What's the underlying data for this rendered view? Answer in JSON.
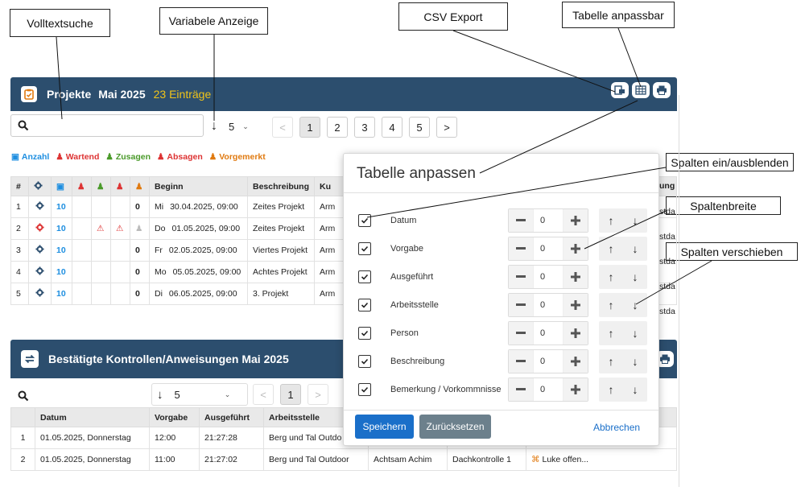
{
  "callouts": {
    "fulltext": "Volltextsuche",
    "variable": "Variabele Anzeige",
    "csv": "CSV Export",
    "table_adjustable": "Tabelle anpassbar",
    "toggle_cols": "Spalten ein/ausblenden",
    "col_width": "Spaltenbreite",
    "move_cols": "Spalten verschieben"
  },
  "projects": {
    "title": "Projekte",
    "period": "Mai 2025",
    "count": "23 Einträge",
    "page_size": "5",
    "pages": [
      "<",
      "1",
      "2",
      "3",
      "4",
      "5",
      ">"
    ],
    "legend": [
      {
        "label": "Anzahl",
        "color": "#1d8ee0"
      },
      {
        "label": "Wartend",
        "color": "#d33"
      },
      {
        "label": "Zusagen",
        "color": "#4a9a2a"
      },
      {
        "label": "Absagen",
        "color": "#d33"
      },
      {
        "label": "Vorgemerkt",
        "color": "#e07a10"
      }
    ],
    "columns": [
      "#",
      "",
      "",
      "",
      "",
      "",
      "",
      "Beginn",
      "Beschreibung",
      "Ku"
    ],
    "rows": [
      {
        "no": "1",
        "n": "10",
        "c5": "0",
        "day": "Mi",
        "date": "30.04.2025, 09:00",
        "desc": "Zeites Projekt",
        "cust": "Arm",
        "tail": "stda",
        "gear": "#2c4e6e",
        "warn": false
      },
      {
        "no": "2",
        "n": "10",
        "c5": "",
        "day": "Do",
        "date": "01.05.2025, 09:00",
        "desc": "Zeites Projekt",
        "cust": "Arm",
        "tail": "stda",
        "gear": "#d33",
        "warn": true
      },
      {
        "no": "3",
        "n": "10",
        "c5": "0",
        "day": "Fr",
        "date": "02.05.2025, 09:00",
        "desc": "Viertes Projekt",
        "cust": "Arm",
        "tail": "stda",
        "gear": "#2c4e6e",
        "warn": false
      },
      {
        "no": "4",
        "n": "10",
        "c5": "0",
        "day": "Mo",
        "date": "05.05.2025, 09:00",
        "desc": "Achtes Projekt",
        "cust": "Arm",
        "tail": "stda",
        "gear": "#2c4e6e",
        "warn": false
      },
      {
        "no": "5",
        "n": "10",
        "c5": "0",
        "day": "Di",
        "date": "06.05.2025, 09:00",
        "desc": "3. Projekt",
        "cust": "Arm",
        "tail": "stda",
        "gear": "#2c4e6e",
        "warn": false
      }
    ],
    "right_header": "ung"
  },
  "controls": {
    "title": "Bestätigte Kontrollen/Anweisungen Mai 2025",
    "page_size": "5",
    "pages": [
      "<",
      "1",
      ">"
    ],
    "columns": [
      "",
      "Datum",
      "Vorgabe",
      "Ausgeführt",
      "Arbeitsstelle"
    ],
    "rows": [
      {
        "no": "1",
        "date": "01.05.2025, Donnerstag",
        "vorgabe": "12:00",
        "ausg": "21:27:28",
        "stelle": "Berg und Tal Outdo",
        "person": "",
        "besch": "",
        "bem": ""
      },
      {
        "no": "2",
        "date": "01.05.2025, Donnerstag",
        "vorgabe": "11:00",
        "ausg": "21:27:02",
        "stelle": "Berg und Tal Outdoor",
        "person": "Achtsam Achim",
        "besch": "Dachkontrolle 1",
        "bem": "Luke offen..."
      }
    ]
  },
  "modal": {
    "title": "Tabelle anpassen",
    "rows": [
      {
        "label": "Datum",
        "value": "0"
      },
      {
        "label": "Vorgabe",
        "value": "0"
      },
      {
        "label": "Ausgeführt",
        "value": "0"
      },
      {
        "label": "Arbeitsstelle",
        "value": "0"
      },
      {
        "label": "Person",
        "value": "0"
      },
      {
        "label": "Beschreibung",
        "value": "0"
      },
      {
        "label": "Bemerkung / Vorkommnisse",
        "value": "0"
      }
    ],
    "save": "Speichern",
    "reset": "Zurücksetzen",
    "cancel": "Abbrechen"
  }
}
